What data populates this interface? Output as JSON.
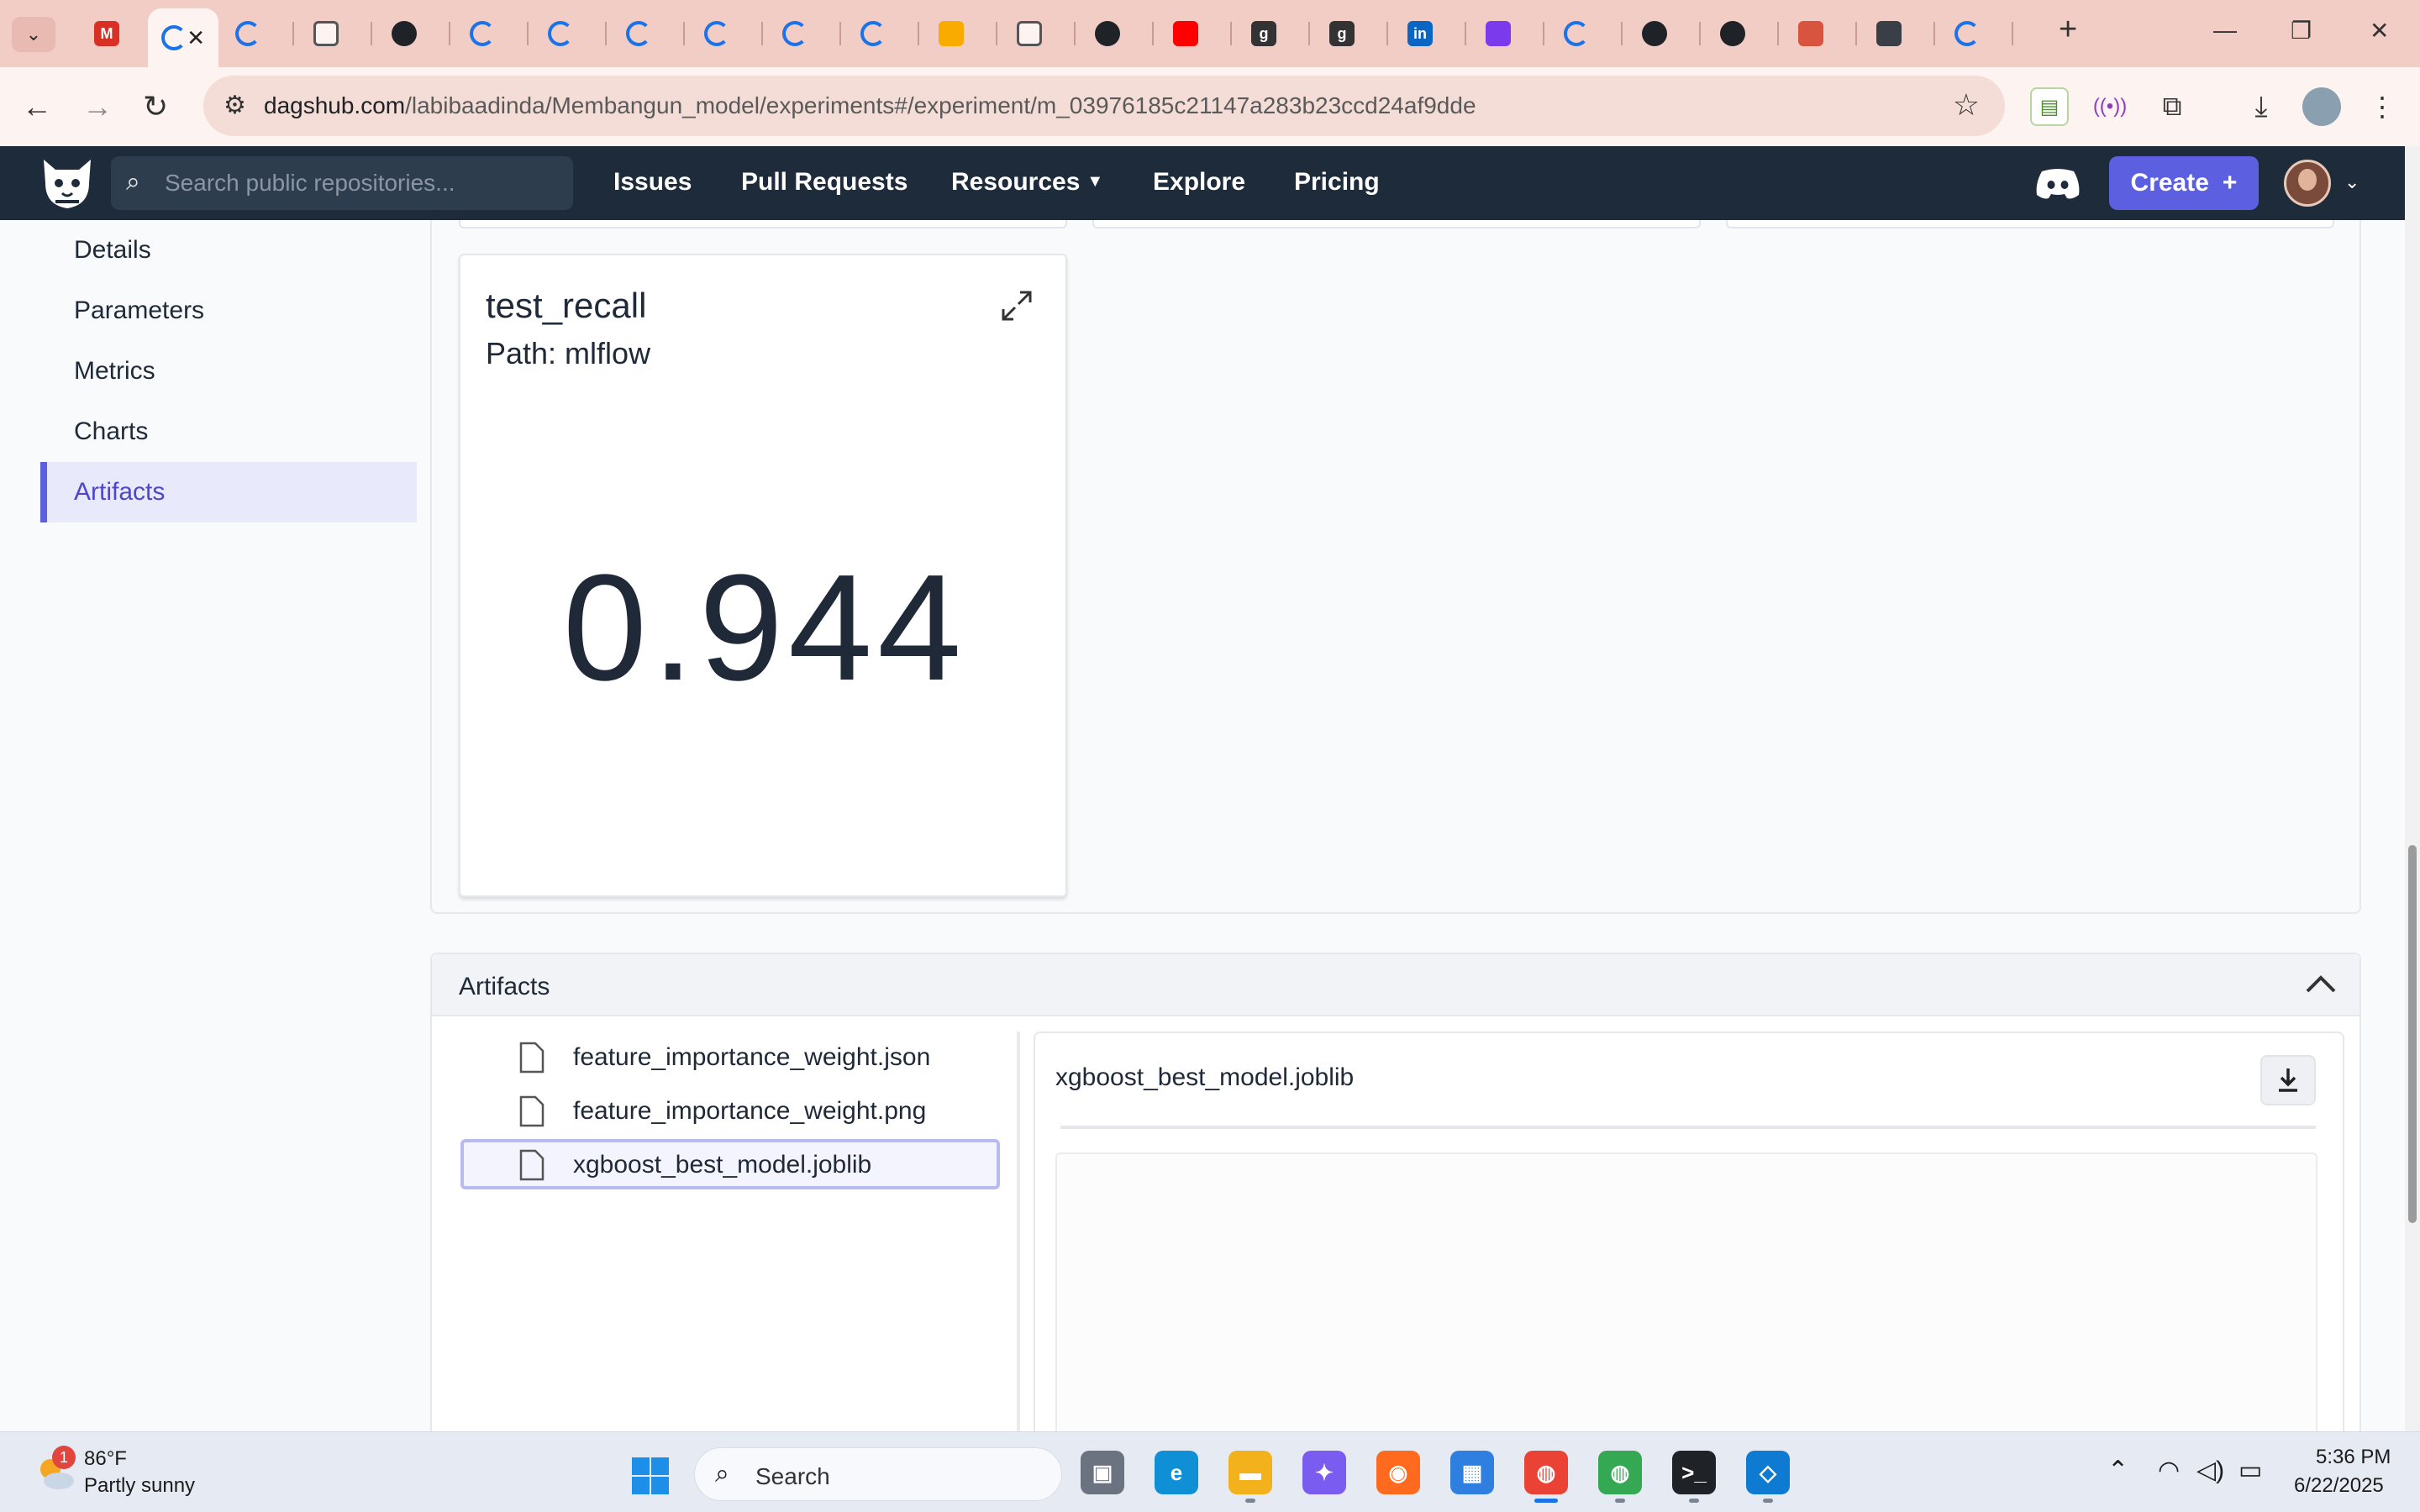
{
  "browser": {
    "tabs": [
      {
        "icon": "gmail-icon",
        "color": "#d93025",
        "glyph": "M"
      },
      {
        "icon": "loading-icon",
        "color": "#1a73e8",
        "glyph": "",
        "active": true
      },
      {
        "icon": "loading-icon",
        "color": "#1a73e8",
        "glyph": ""
      },
      {
        "icon": "dagshub-icon",
        "color": "#ffffff",
        "glyph": ""
      },
      {
        "icon": "github-icon",
        "color": "#1f2328",
        "glyph": ""
      },
      {
        "icon": "loading-icon",
        "color": "#1a73e8",
        "glyph": ""
      },
      {
        "icon": "loading-icon",
        "color": "#1a73e8",
        "glyph": ""
      },
      {
        "icon": "loading-icon",
        "color": "#1a73e8",
        "glyph": ""
      },
      {
        "icon": "loading-icon",
        "color": "#1a73e8",
        "glyph": ""
      },
      {
        "icon": "loading-icon",
        "color": "#1a73e8",
        "glyph": ""
      },
      {
        "icon": "loading-icon",
        "color": "#1a73e8",
        "glyph": ""
      },
      {
        "icon": "colab-icon",
        "color": "#f9ab00",
        "glyph": ""
      },
      {
        "icon": "dagshub-icon",
        "color": "#ffffff",
        "glyph": ""
      },
      {
        "icon": "github-icon",
        "color": "#1f2328",
        "glyph": ""
      },
      {
        "icon": "youtube-icon",
        "color": "#ff0000",
        "glyph": ""
      },
      {
        "icon": "g-icon",
        "color": "#333333",
        "glyph": "g"
      },
      {
        "icon": "g-icon",
        "color": "#333333",
        "glyph": "g"
      },
      {
        "icon": "linkedin-icon",
        "color": "#0a66c2",
        "glyph": "in"
      },
      {
        "icon": "purple-app-icon",
        "color": "#7c3aed",
        "glyph": ""
      },
      {
        "icon": "loading-icon",
        "color": "#1a73e8",
        "glyph": ""
      },
      {
        "icon": "github-icon",
        "color": "#1f2328",
        "glyph": ""
      },
      {
        "icon": "github-icon",
        "color": "#1f2328",
        "glyph": ""
      },
      {
        "icon": "flame-icon",
        "color": "#d9543f",
        "glyph": ""
      },
      {
        "icon": "docker-icon",
        "color": "#3a3f47",
        "glyph": ""
      },
      {
        "icon": "loading-icon",
        "color": "#1a73e8",
        "glyph": ""
      }
    ],
    "url_domain": "dagshub.com",
    "url_path": "/labibaadinda/Membangun_model/experiments#/experiment/m_03976185c21147a283b23ccd24af9dde"
  },
  "header": {
    "search_placeholder": "Search public repositories...",
    "nav": [
      "Issues",
      "Pull Requests",
      "Resources",
      "Explore",
      "Pricing"
    ],
    "create_label": "Create",
    "brand_color": "#1e2b3a",
    "accent_color": "#5b5fe0"
  },
  "sidebar": {
    "items": [
      {
        "label": "Details",
        "active": false
      },
      {
        "label": "Parameters",
        "active": false
      },
      {
        "label": "Metrics",
        "active": false
      },
      {
        "label": "Charts",
        "active": false
      },
      {
        "label": "Artifacts",
        "active": true
      }
    ]
  },
  "metric_card": {
    "title": "test_recall",
    "path": "Path: mlflow",
    "value": "0.944"
  },
  "artifacts": {
    "title": "Artifacts",
    "files": [
      {
        "name": "feature_importance_weight.json",
        "selected": false
      },
      {
        "name": "feature_importance_weight.png",
        "selected": false
      },
      {
        "name": "xgboost_best_model.joblib",
        "selected": true
      }
    ],
    "preview_name": "xgboost_best_model.joblib"
  },
  "taskbar": {
    "weather_badge": "1",
    "temperature": "86°F",
    "condition": "Partly sunny",
    "search_label": "Search",
    "time": "5:36 PM",
    "date": "6/22/2025"
  }
}
